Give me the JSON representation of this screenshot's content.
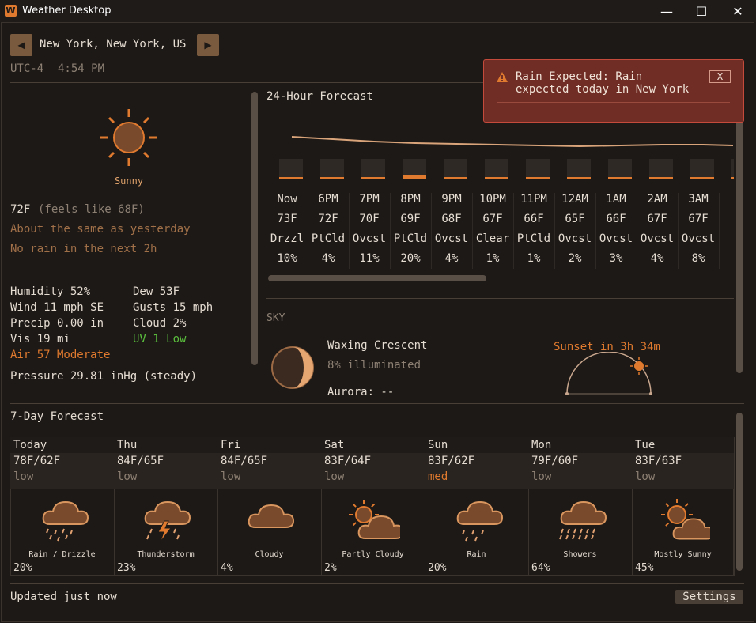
{
  "window": {
    "app_icon": "W",
    "title": "Weather Desktop",
    "minimize": "—",
    "maximize": "☐",
    "close": "✕"
  },
  "location": {
    "name": "New York, New York, US",
    "timezone": "UTC-4",
    "time": "4:54 PM",
    "prev_arrow": "◀",
    "next_arrow": "▶"
  },
  "current": {
    "condition": "Sunny",
    "temp": "72F",
    "feels_like": "(feels like 68F)",
    "compare": "About the same as yesterday",
    "rain_note": "No rain in the next 2h",
    "humidity": "Humidity 52%",
    "dew": "Dew 53F",
    "wind": "Wind 11 mph SE",
    "gusts": "Gusts 15 mph",
    "precip": "Precip 0.00 in",
    "cloud": "Cloud 2%",
    "vis": "Vis 19 mi",
    "uv": "UV 1 Low",
    "air": "Air 57 Moderate",
    "pressure": "Pressure 29.81 inHg (steady)"
  },
  "hourly": {
    "title": "24-Hour Forecast",
    "hours": [
      {
        "time": "Now",
        "temp": "73F",
        "cond": "Drzzl",
        "pop": "10%",
        "pop_value": 10
      },
      {
        "time": "6PM",
        "temp": "72F",
        "cond": "PtCld",
        "pop": "4%",
        "pop_value": 4
      },
      {
        "time": "7PM",
        "temp": "70F",
        "cond": "Ovcst",
        "pop": "11%",
        "pop_value": 11
      },
      {
        "time": "8PM",
        "temp": "69F",
        "cond": "PtCld",
        "pop": "20%",
        "pop_value": 20
      },
      {
        "time": "9PM",
        "temp": "68F",
        "cond": "Ovcst",
        "pop": "4%",
        "pop_value": 4
      },
      {
        "time": "10PM",
        "temp": "67F",
        "cond": "Clear",
        "pop": "1%",
        "pop_value": 1
      },
      {
        "time": "11PM",
        "temp": "66F",
        "cond": "PtCld",
        "pop": "1%",
        "pop_value": 1
      },
      {
        "time": "12AM",
        "temp": "65F",
        "cond": "Ovcst",
        "pop": "2%",
        "pop_value": 2
      },
      {
        "time": "1AM",
        "temp": "66F",
        "cond": "Ovcst",
        "pop": "3%",
        "pop_value": 3
      },
      {
        "time": "2AM",
        "temp": "67F",
        "cond": "Ovcst",
        "pop": "4%",
        "pop_value": 4
      },
      {
        "time": "3AM",
        "temp": "67F",
        "cond": "Ovcst",
        "pop": "8%",
        "pop_value": 8
      },
      {
        "time": "",
        "temp": "",
        "cond": "O",
        "pop": "",
        "pop_value": 8
      }
    ]
  },
  "sky": {
    "label": "SKY",
    "moon_phase": "Waxing Crescent",
    "illumination": "8% illuminated",
    "aurora": "Aurora: --",
    "sunset": "Sunset in 3h 34m"
  },
  "daily": {
    "title": "7-Day Forecast",
    "days": [
      {
        "name": "Today",
        "temps": "78F/62F",
        "risk": "low",
        "caption": "Rain / Drizzle",
        "pop": "20%",
        "icon": "rain-drizzle-icon"
      },
      {
        "name": "Thu",
        "temps": "84F/65F",
        "risk": "low",
        "caption": "Thunderstorm",
        "pop": "23%",
        "icon": "thunderstorm-icon"
      },
      {
        "name": "Fri",
        "temps": "84F/65F",
        "risk": "low",
        "caption": "Cloudy",
        "pop": "4%",
        "icon": "cloud-icon"
      },
      {
        "name": "Sat",
        "temps": "83F/64F",
        "risk": "low",
        "caption": "Partly Cloudy",
        "pop": "2%",
        "icon": "partly-cloudy-icon"
      },
      {
        "name": "Sun",
        "temps": "83F/62F",
        "risk": "med",
        "caption": "Rain",
        "pop": "20%",
        "icon": "rain-icon"
      },
      {
        "name": "Mon",
        "temps": "79F/60F",
        "risk": "low",
        "caption": "Showers",
        "pop": "64%",
        "icon": "showers-icon"
      },
      {
        "name": "Tue",
        "temps": "83F/63F",
        "risk": "low",
        "caption": "Mostly Sunny",
        "pop": "45%",
        "icon": "mostly-sunny-icon"
      }
    ]
  },
  "alert": {
    "message": "Rain Expected: Rain expected today in New York",
    "close_label": "X"
  },
  "footer": {
    "updated": "Updated just now",
    "settings_label": "Settings"
  },
  "colors": {
    "background": "#1d1917",
    "accent": "#e07a2e",
    "text": "#e6ddd2",
    "muted": "#8d8073",
    "uv_green": "#5bbf3d",
    "alert_bg": "#702d25"
  }
}
